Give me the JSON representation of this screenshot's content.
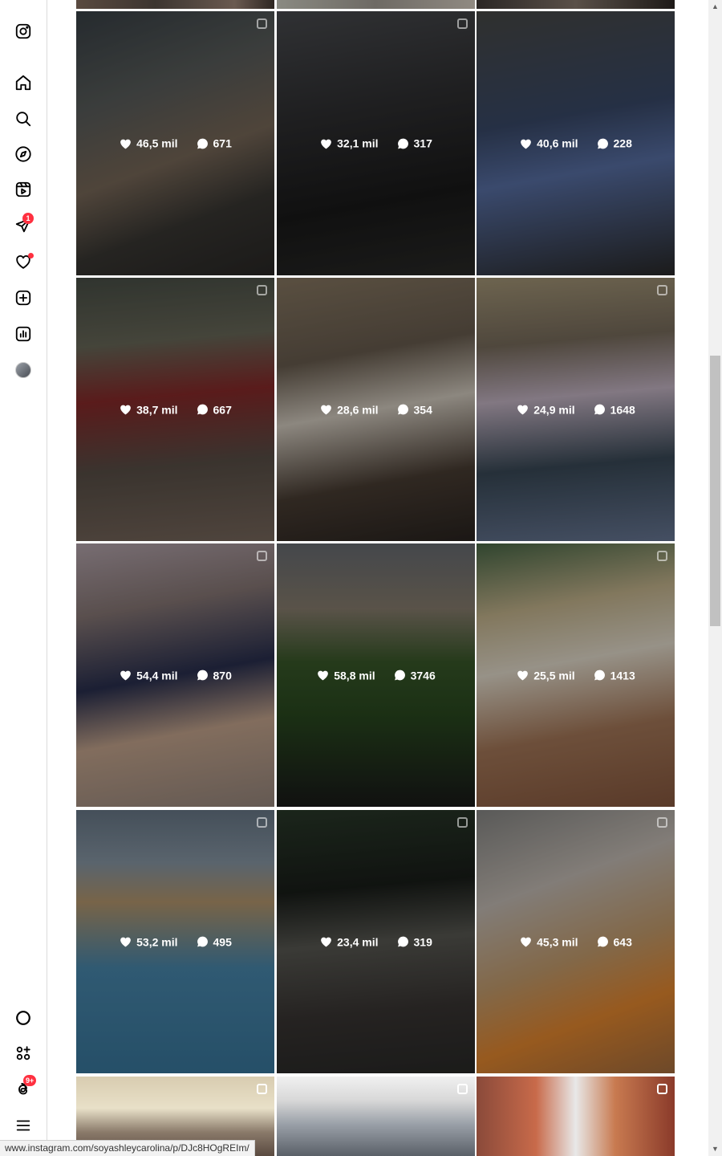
{
  "sidebar": {
    "badges": {
      "messages": "1",
      "threads": "9+"
    }
  },
  "posts": [
    {
      "likes": "46,5 mil",
      "comments": "671"
    },
    {
      "likes": "32,1 mil",
      "comments": "317"
    },
    {
      "likes": "40,6 mil",
      "comments": "228"
    },
    {
      "likes": "38,7 mil",
      "comments": "667"
    },
    {
      "likes": "28,6 mil",
      "comments": "354"
    },
    {
      "likes": "24,9 mil",
      "comments": "1648"
    },
    {
      "likes": "54,4 mil",
      "comments": "870"
    },
    {
      "likes": "58,8 mil",
      "comments": "3746"
    },
    {
      "likes": "25,5 mil",
      "comments": "1413"
    },
    {
      "likes": "53,2 mil",
      "comments": "495"
    },
    {
      "likes": "23,4 mil",
      "comments": "319"
    },
    {
      "likes": "45,3 mil",
      "comments": "643"
    }
  ],
  "status_url": "www.instagram.com/soyashleycarolina/p/DJc8HOgREIm/",
  "colors": {
    "badge": "#ff3040",
    "border": "#dbdbdb"
  }
}
